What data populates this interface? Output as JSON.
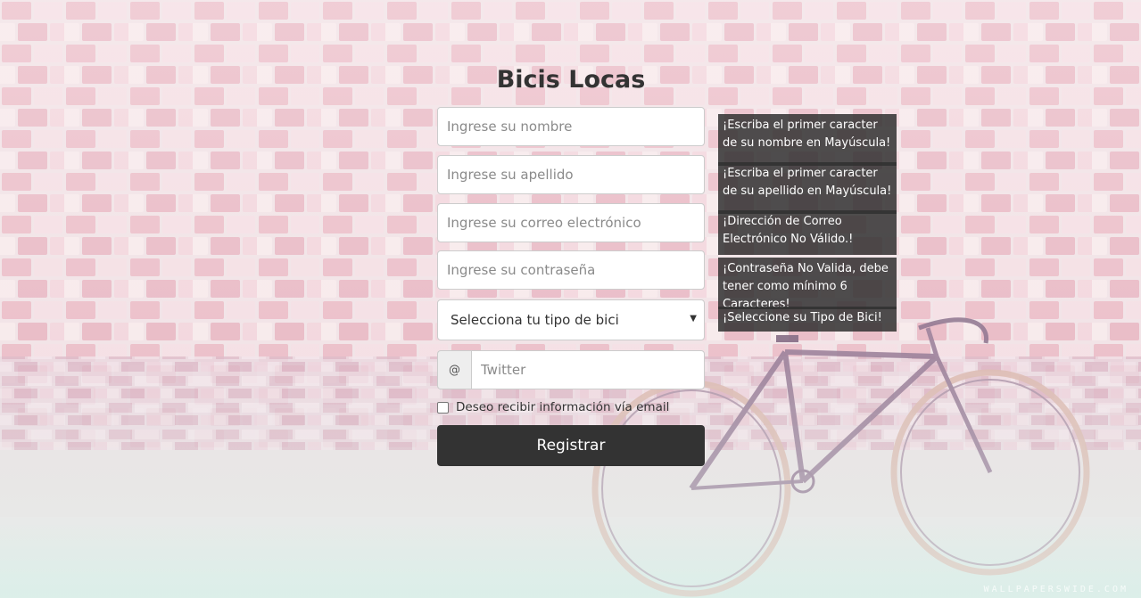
{
  "page": {
    "title": "Bicis Locas",
    "watermark": "WALLPAPERSWIDE.COM"
  },
  "form": {
    "nombre": {
      "placeholder": "Ingrese su nombre"
    },
    "apellido": {
      "placeholder": "Ingrese su apellido"
    },
    "correo": {
      "placeholder": "Ingrese su correo electrónico"
    },
    "contrasena": {
      "placeholder": "Ingrese su contraseña"
    },
    "tipo_bici": {
      "selected": "Selecciona tu tipo de bici",
      "arrow": "▼"
    },
    "twitter": {
      "addon": "@",
      "placeholder": "Twitter"
    },
    "newsletter": {
      "label": "Deseo recibir información vía email",
      "checked": false
    },
    "submit_label": "Registrar"
  },
  "tooltips": {
    "nombre": "¡Escriba el primer caracter de su nombre en Mayúscula!",
    "apellido": "¡Escriba el primer caracter de su apellido en Mayúscula!",
    "correo": "¡Dirección de Correo Electrónico No Válido.!",
    "contrasena": "¡Contraseña No Valida, debe tener como mínimo 6 Caracteres!",
    "tipo_bici": "¡Seleccione su Tipo de Bici!"
  },
  "colors": {
    "button_bg": "#333333",
    "tooltip_bg": "#303030",
    "title": "#333333"
  }
}
